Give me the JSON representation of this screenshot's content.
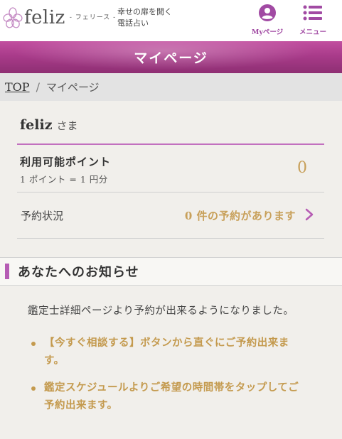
{
  "header": {
    "logo_text": "feliz",
    "logo_sub": "- フェリース -",
    "tagline_line1": "幸せの扉を開く",
    "tagline_line2": "電話占い",
    "mypage_label": "Myページ",
    "menu_label": "メニュー"
  },
  "banner": {
    "title": "マイページ"
  },
  "breadcrumb": {
    "top": "TOP",
    "separator": "/",
    "current": "マイページ"
  },
  "user": {
    "name": "feliz",
    "honorific": "さま"
  },
  "points": {
    "label": "利用可能ポイント",
    "rate": "1 ポイント = 1 円分",
    "value": "0"
  },
  "booking": {
    "label": "予約状況",
    "status": "0 件の予約があります"
  },
  "notice": {
    "title": "あなたへのお知らせ",
    "intro": "鑑定士詳細ページより予約が出来るようになりました。",
    "items": [
      {
        "line1": "【今すぐ相談する】ボタンから直ぐにご予約出来ま",
        "line2": "す。"
      },
      {
        "line1": "鑑定スケジュールよりご希望の時間帯をタップしてご",
        "line2": "予約出来ます。"
      }
    ]
  },
  "colors": {
    "accent": "#b65cb4",
    "gold": "#c8a05a",
    "banner": "#a93b8a"
  },
  "icons": {
    "logo": "flower-icon",
    "mypage": "user-icon",
    "menu": "list-menu-icon",
    "booking": "chevron-right-icon"
  }
}
